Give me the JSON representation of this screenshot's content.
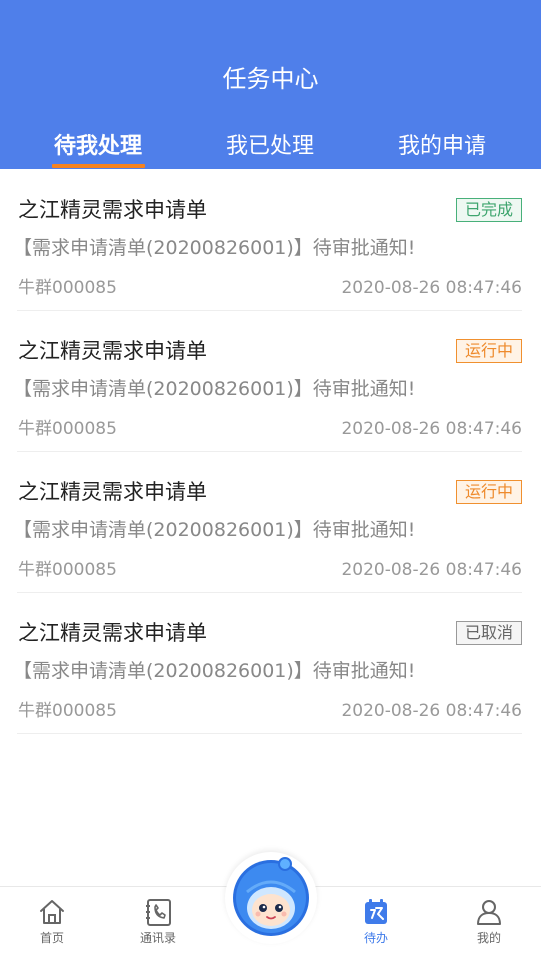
{
  "header": {
    "title": "任务中心",
    "tabs": [
      {
        "label": "待我处理"
      },
      {
        "label": "我已处理"
      },
      {
        "label": "我的申请"
      }
    ]
  },
  "items": [
    {
      "title": "之江精灵需求申请单",
      "status": "已完成",
      "desc": "【需求申请清单(20200826001)】待审批通知!",
      "user": "牛群000085",
      "time": "2020-08-26 08:47:46"
    },
    {
      "title": "之江精灵需求申请单",
      "status": "运行中",
      "desc": "【需求申请清单(20200826001)】待审批通知!",
      "user": "牛群000085",
      "time": "2020-08-26 08:47:46"
    },
    {
      "title": "之江精灵需求申请单",
      "status": "运行中",
      "desc": "【需求申请清单(20200826001)】待审批通知!",
      "user": "牛群000085",
      "time": "2020-08-26 08:47:46"
    },
    {
      "title": "之江精灵需求申请单",
      "status": "已取消",
      "desc": "【需求申请清单(20200826001)】待审批通知!",
      "user": "牛群000085",
      "time": "2020-08-26 08:47:46"
    }
  ],
  "tabbar": {
    "home": "首页",
    "contacts": "通讯录",
    "mascot_icon": "mascot-robot-icon",
    "todo": "待办",
    "mine": "我的"
  },
  "colors": {
    "header_bg": "#4f7fea",
    "tab_underline": "#f5821f",
    "status_done": "#3ea56e",
    "status_running": "#ee8a2c",
    "status_cancelled": "#666666",
    "tabbar_active": "#3f7bea"
  }
}
